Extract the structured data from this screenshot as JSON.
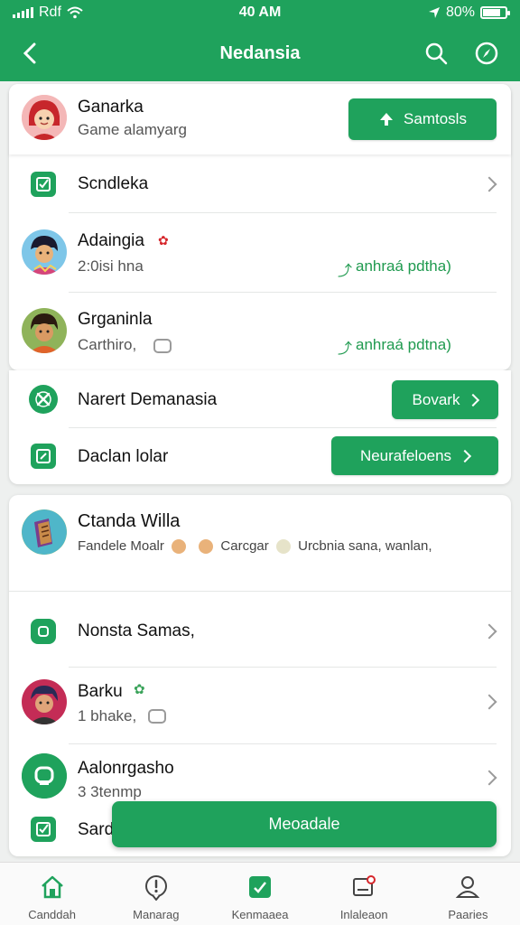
{
  "status_bar": {
    "carrier": "Rdf",
    "time": "40 AM",
    "battery": "80%",
    "battery_level": 0.8
  },
  "app_bar": {
    "title": "Nedansia"
  },
  "profile": {
    "name": "Ganarka",
    "subtitle": "Game alamyarg",
    "button_label": "Samtosls"
  },
  "group1": {
    "menu_item": "Scndleka",
    "contacts": [
      {
        "name": "Adaingia",
        "subtitle": "2:0isi hna",
        "action": "anhraá pdtha)"
      },
      {
        "name": "Grganinla",
        "subtitle": "Carthiro,",
        "action": "anhraá pdtna)"
      }
    ]
  },
  "group2": {
    "items": [
      {
        "label": "Narert Demanasia",
        "button": "Bovark"
      },
      {
        "label": "Daclan lolar",
        "button": "Neurafeloens"
      }
    ]
  },
  "group3": {
    "featured": {
      "name": "Ctanda Willa",
      "detail1": "Fandele Moalr",
      "detail2": "Carcgar",
      "detail3": "Urcbnia sana, wanlan,"
    },
    "menu_item": "Nonsta Samas,",
    "contacts": [
      {
        "name": "Barku",
        "subtitle": "1 bhake,"
      },
      {
        "name": "Aalonrgasho",
        "subtitle": "3 3tenmp"
      }
    ],
    "last_item": "Sard"
  },
  "fab": {
    "label": "Meoadale"
  },
  "tabs": [
    {
      "label": "Canddah",
      "icon": "home-icon"
    },
    {
      "label": "Manarag",
      "icon": "alert-icon"
    },
    {
      "label": "Kenmaaea",
      "icon": "chat-check-icon"
    },
    {
      "label": "Inlaleaon",
      "icon": "inbox-icon"
    },
    {
      "label": "Paaries",
      "icon": "user-icon"
    }
  ],
  "colors": {
    "primary": "#1fa25c",
    "link_green": "#1f9a4f",
    "background": "#eef0ef"
  }
}
